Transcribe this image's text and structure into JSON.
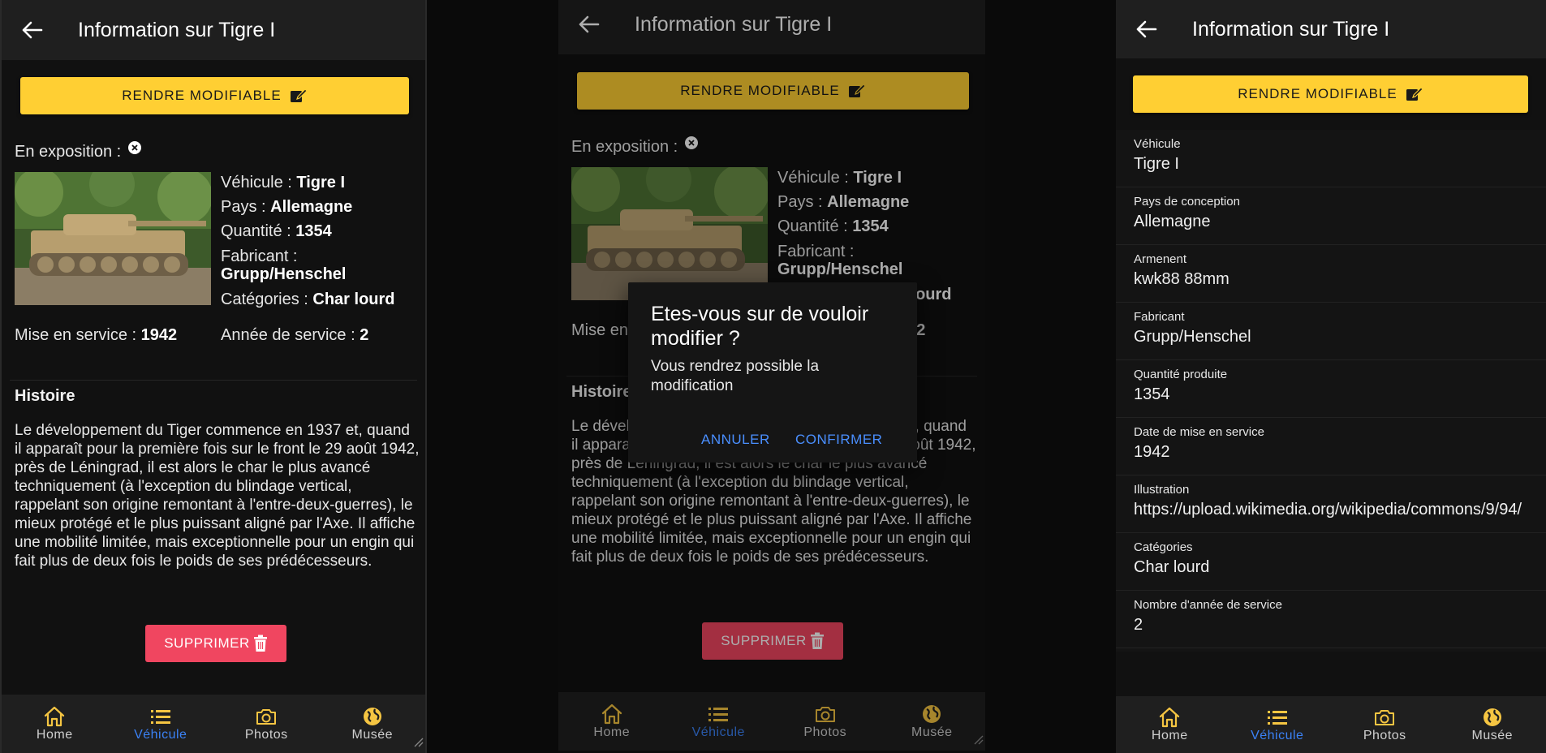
{
  "screen_title": "Information sur Tigre I",
  "edit_button": "RENDRE MODIFIABLE",
  "delete_button": "SUPPRIMER",
  "exposition_label": "En exposition :",
  "vehicle_info": {
    "vehicule_label": "Véhicule : ",
    "vehicule_value": "Tigre I",
    "pays_label": "Pays : ",
    "pays_value": "Allemagne",
    "quantite_label": "Quantité : ",
    "quantite_value": "1354",
    "fabricant_label": "Fabricant : ",
    "fabricant_value": "Grupp/Henschel",
    "categories_label": "Catégories : ",
    "categories_value": "Char lourd",
    "mise_label": "Mise en service : ",
    "mise_value": "1942",
    "annee_label": "Année de service : ",
    "annee_value": "2"
  },
  "histoire": {
    "title": "Histoire",
    "text": "Le développement du Tiger commence en 1937 et, quand il apparaît pour la première fois sur le front le 29 août 1942, près de Léningrad, il est alors le char le plus avancé techniquement (à l'exception du blindage vertical, rappelant son origine remontant à l'entre-deux-guerres), le mieux protégé et le plus puissant aligné par l'Axe. Il affiche une mobilité limitée, mais exceptionnelle pour un engin qui fait plus de deux fois le poids de ses prédécesseurs."
  },
  "nav": [
    {
      "label": "Home",
      "icon": "home-icon"
    },
    {
      "label": "Véhicule",
      "icon": "list-icon",
      "active": true
    },
    {
      "label": "Photos",
      "icon": "camera-icon"
    },
    {
      "label": "Musée",
      "icon": "globe-icon"
    }
  ],
  "dialog": {
    "title": "Etes-vous sur de vouloir modifier ?",
    "body": "Vous rendrez possible la modification",
    "cancel": "ANNULER",
    "confirm": "CONFIRMER"
  },
  "form": [
    {
      "label": "Véhicule",
      "value": "Tigre I"
    },
    {
      "label": "Pays de conception",
      "value": "Allemagne"
    },
    {
      "label": "Armenent",
      "value": "kwk88 88mm"
    },
    {
      "label": "Fabricant",
      "value": "Grupp/Henschel"
    },
    {
      "label": "Quantité produite",
      "value": "1354"
    },
    {
      "label": "Date de mise en service",
      "value": "1942"
    },
    {
      "label": "Illustration",
      "value": "https://upload.wikimedia.org/wikipedia/commons/9/94/"
    },
    {
      "label": "Catégories",
      "value": "Char lourd"
    },
    {
      "label": "Nombre d'année de service",
      "value": "2"
    }
  ],
  "colors": {
    "accent_yellow": "#ffcf33",
    "delete_red": "#f04660",
    "active_blue": "#3b82f6",
    "background": "#111111",
    "bar": "#1f1f1f"
  }
}
